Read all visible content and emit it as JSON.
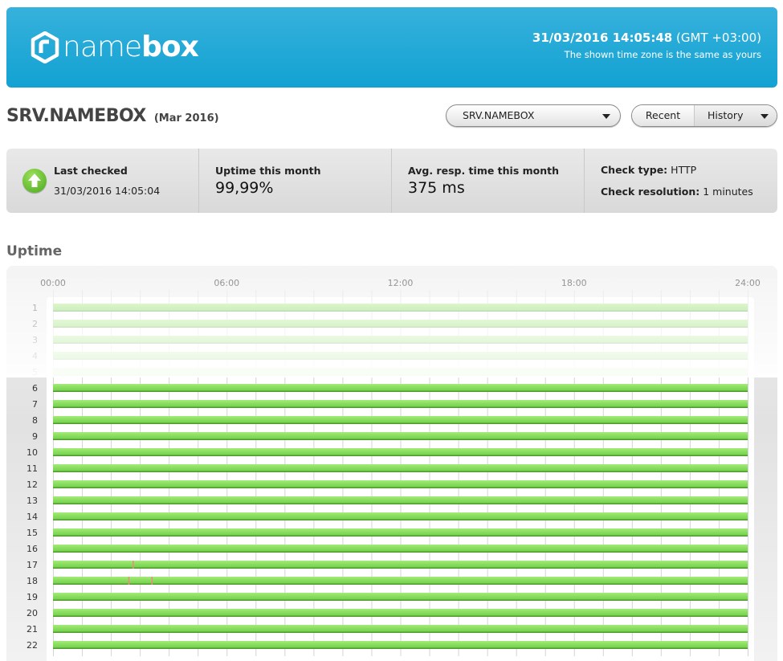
{
  "header": {
    "logo_light": "name",
    "logo_bold": "box",
    "datetime": "31/03/2016 14:05:48",
    "timezone": "(GMT +03:00)",
    "timezone_note": "The shown time zone is the same as yours",
    "brand_color": "#1ea8d6"
  },
  "page": {
    "title": "SRV.NAMEBOX",
    "period": "(Mar 2016)"
  },
  "controls": {
    "server_select": {
      "value": "SRV.NAMEBOX"
    },
    "mode_tabs": [
      {
        "label": "Recent",
        "active": false
      },
      {
        "label": "History",
        "active": true
      }
    ]
  },
  "stats": {
    "last_checked": {
      "label": "Last checked",
      "value": "31/03/2016 14:05:04",
      "status": "up",
      "icon": "arrow-up-icon"
    },
    "uptime": {
      "label": "Uptime this month",
      "value": "99,99%"
    },
    "avg_response": {
      "label": "Avg. resp. time this month",
      "value": "375 ms"
    },
    "check_type": {
      "label": "Check type:",
      "value": "HTTP"
    },
    "check_resolution": {
      "label": "Check resolution:",
      "value": "1 minutes"
    }
  },
  "uptime_section": {
    "title": "Uptime"
  },
  "chart_data": {
    "type": "timeline",
    "title": "Uptime",
    "x_ticks": [
      "00:00",
      "06:00",
      "12:00",
      "18:00",
      "24:00"
    ],
    "x_range_hours": [
      0,
      24
    ],
    "grid_interval_hours": 1,
    "rows": [
      {
        "day": "1",
        "status": "up",
        "outages": []
      },
      {
        "day": "2",
        "status": "up",
        "outages": []
      },
      {
        "day": "3",
        "status": "up",
        "outages": []
      },
      {
        "day": "4",
        "status": "up",
        "outages": []
      },
      {
        "day": "5",
        "status": "up",
        "outages": []
      },
      {
        "day": "6",
        "status": "up",
        "outages": []
      },
      {
        "day": "7",
        "status": "up",
        "outages": []
      },
      {
        "day": "8",
        "status": "up",
        "outages": []
      },
      {
        "day": "9",
        "status": "up",
        "outages": []
      },
      {
        "day": "10",
        "status": "up",
        "outages": []
      },
      {
        "day": "11",
        "status": "up",
        "outages": []
      },
      {
        "day": "12",
        "status": "up",
        "outages": []
      },
      {
        "day": "13",
        "status": "up",
        "outages": []
      },
      {
        "day": "14",
        "status": "up",
        "outages": []
      },
      {
        "day": "15",
        "status": "up",
        "outages": []
      },
      {
        "day": "16",
        "status": "up",
        "outages": []
      },
      {
        "day": "17",
        "status": "up",
        "outages": [
          2.75
        ]
      },
      {
        "day": "18",
        "status": "up",
        "outages": [
          2.6,
          3.4
        ]
      },
      {
        "day": "19",
        "status": "up",
        "outages": []
      },
      {
        "day": "20",
        "status": "up",
        "outages": []
      },
      {
        "day": "21",
        "status": "up",
        "outages": []
      },
      {
        "day": "22",
        "status": "up",
        "outages": []
      }
    ],
    "colors": {
      "up": "#7fd956",
      "up_dark": "#4e9a2a",
      "down": "#f08a80",
      "grid": "#d4d4d4"
    }
  }
}
